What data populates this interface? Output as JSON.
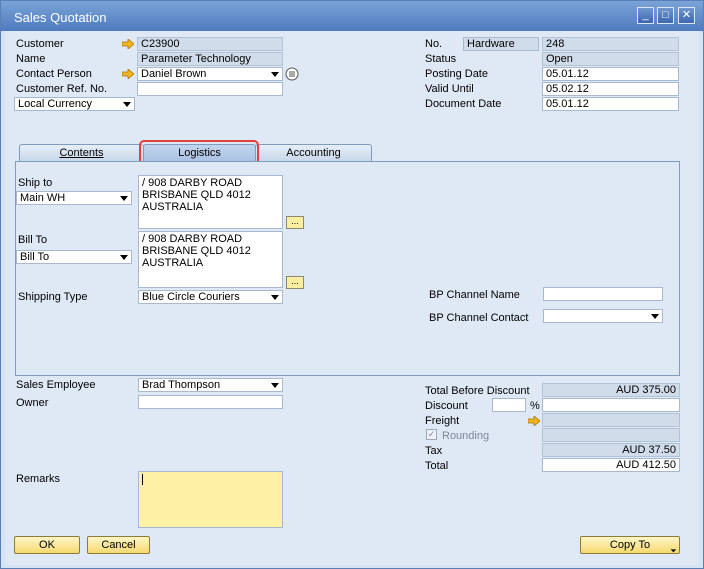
{
  "window": {
    "title": "Sales Quotation",
    "buttons": [
      "_",
      "□",
      "✕"
    ]
  },
  "header_left": {
    "customer_label": "Customer",
    "customer_value": "C23900",
    "name_label": "Name",
    "name_value": "Parameter Technology",
    "contact_label": "Contact Person",
    "contact_value": "Daniel Brown",
    "ref_label": "Customer Ref. No.",
    "ref_value": "",
    "currency_value": "Local Currency"
  },
  "header_right": {
    "no_label": "No.",
    "series_value": "Hardware",
    "no_value": "248",
    "status_label": "Status",
    "status_value": "Open",
    "posting_label": "Posting Date",
    "posting_value": "05.01.12",
    "valid_label": "Valid Until",
    "valid_value": "05.02.12",
    "docdate_label": "Document Date",
    "docdate_value": "05.01.12"
  },
  "tabs": [
    {
      "label": "Contents"
    },
    {
      "label": "Logistics"
    },
    {
      "label": "Accounting"
    }
  ],
  "logistics": {
    "ship_to_label": "Ship to",
    "ship_to_select": "Main WH",
    "ship_to_address": "/ 908 DARBY ROAD\nBRISBANE QLD 4012\nAUSTRALIA",
    "bill_to_label": "Bill To",
    "bill_to_select": "Bill To",
    "bill_to_address": "/ 908 DARBY ROAD\nBRISBANE QLD 4012\nAUSTRALIA",
    "shipping_type_label": "Shipping Type",
    "shipping_type_value": "Blue Circle Couriers",
    "bp_channel_name_label": "BP Channel Name",
    "bp_channel_name_value": "",
    "bp_channel_contact_label": "BP Channel Contact",
    "bp_channel_contact_value": "",
    "ellipsis": "..."
  },
  "footer_left": {
    "sales_employee_label": "Sales Employee",
    "sales_employee_value": "Brad Thompson",
    "owner_label": "Owner",
    "owner_value": "",
    "remarks_label": "Remarks",
    "remarks_value": ""
  },
  "totals": {
    "before_discount_label": "Total Before Discount",
    "before_discount_value": "AUD 375.00",
    "discount_label": "Discount",
    "discount_pct": "",
    "pct_sign": "%",
    "discount_value": "",
    "freight_label": "Freight",
    "freight_value": "",
    "rounding_label": "Rounding",
    "rounding_value": "",
    "tax_label": "Tax",
    "tax_value": "AUD 37.50",
    "total_label": "Total",
    "total_value": "AUD 412.50"
  },
  "buttons": {
    "ok": "OK",
    "cancel": "Cancel",
    "copy_to": "Copy To"
  },
  "colors": {
    "highlight": "#e0403f",
    "link_arrow": "#f2b61c"
  }
}
